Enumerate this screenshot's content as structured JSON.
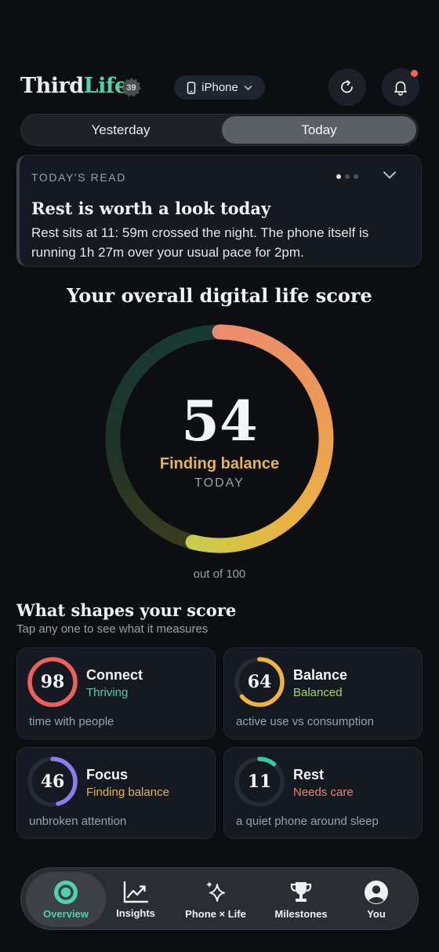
{
  "header": {
    "brand_part1": "Third",
    "brand_part2": "Life",
    "badge": "39",
    "device": "iPhone"
  },
  "tabs": {
    "yesterday": "Yesterday",
    "today": "Today",
    "selected": "Today"
  },
  "read_card": {
    "kicker": "TODAY'S READ",
    "title": "Rest is worth a look today",
    "body": "Rest sits at 11: 59m crossed the night. The phone itself is running 1h 27m over your usual pace for 2pm.",
    "page_count": 3,
    "current_page": 1
  },
  "score": {
    "title": "Your overall digital life score",
    "value": "54",
    "value_number": 54,
    "max": 100,
    "status": "Finding balance",
    "period": "TODAY",
    "out_of": "out of 100"
  },
  "factors": {
    "title": "What shapes your score",
    "subtitle": "Tap any one to see what it measures",
    "items": [
      {
        "name": "Connect",
        "value": "98",
        "value_number": 98,
        "status": "Thriving",
        "description": "time with people",
        "color": "#f0605a",
        "status_color": "#4fd1ae"
      },
      {
        "name": "Balance",
        "value": "64",
        "value_number": 64,
        "status": "Balanced",
        "description": "active use vs consumption",
        "color": "#f0b43c",
        "status_color": "#a6d36b"
      },
      {
        "name": "Focus",
        "value": "46",
        "value_number": 46,
        "status": "Finding balance",
        "description": "unbroken attention",
        "color": "#8b7cf0",
        "status_color": "#e9b44a"
      },
      {
        "name": "Rest",
        "value": "11",
        "value_number": 11,
        "status": "Needs care",
        "description": "a quiet phone around sleep",
        "color": "#36c9a5",
        "status_color": "#f0806a"
      }
    ]
  },
  "nav": {
    "items": [
      {
        "label": "Overview",
        "icon": "overview-icon",
        "active": true
      },
      {
        "label": "Insights",
        "icon": "insights-chart-icon"
      },
      {
        "label": "Phone × Life",
        "icon": "sparkles-icon"
      },
      {
        "label": "Milestones",
        "icon": "trophy-icon"
      },
      {
        "label": "You",
        "icon": "profile-icon"
      }
    ]
  },
  "colors": {
    "accent": "#4fd1ae",
    "background": "#0c0e12",
    "card": "#141922",
    "warning": "#e9b44a",
    "notification": "#f0664f"
  }
}
